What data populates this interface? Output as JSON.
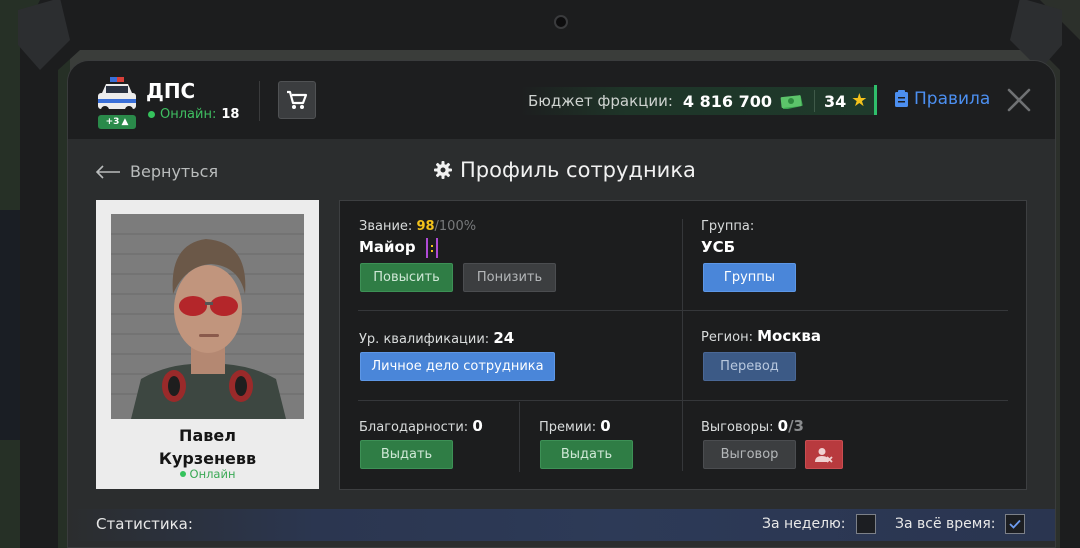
{
  "header": {
    "faction_name": "ДПС",
    "faction_badge": "+3",
    "online_label": "Онлайн:",
    "online_count": "18",
    "budget_label": "Бюджет фракции:",
    "budget_value": "4 816 700",
    "stars_value": "34",
    "rules_label": "Правила"
  },
  "nav": {
    "back_label": "Вернуться",
    "title": "Профиль сотрудника"
  },
  "profile": {
    "first_name": "Павел",
    "last_name": "Курзеневв",
    "status": "Онлайн"
  },
  "info": {
    "rank_label": "Звание:",
    "rank_progress": "98",
    "rank_progress_tail": "/100%",
    "rank_name": "Майор",
    "promote_label": "Повысить",
    "demote_label": "Понизить",
    "group_label": "Группа:",
    "group_name": "УСБ",
    "groups_button": "Группы",
    "qualification_label": "Ур. квалификации:",
    "qualification_value": "24",
    "personal_file_button": "Личное дело сотрудника",
    "region_label": "Регион:",
    "region_value": "Москва",
    "transfer_button": "Перевод",
    "thanks_label": "Благодарности:",
    "thanks_value": "0",
    "thanks_button": "Выдать",
    "bonuses_label": "Премии:",
    "bonuses_value": "0",
    "bonuses_button": "Выдать",
    "reprimands_label": "Выговоры:",
    "reprimands_value": "0",
    "reprimands_max": "/3",
    "reprimand_button": "Выговор"
  },
  "stats": {
    "label": "Статистика:",
    "week_label": "За неделю:",
    "week_checked": false,
    "all_time_label": "За всё время:",
    "all_time_checked": true
  },
  "colors": {
    "accent_green": "#2f7d45",
    "accent_blue": "#4a86d9",
    "rank_yellow": "#f3c21b",
    "online_green": "#35c25c",
    "danger_red": "#b83a3e"
  },
  "icons": [
    "police-car-icon",
    "cart-icon",
    "cash-icon",
    "star-icon",
    "clipboard-icon",
    "close-icon",
    "arrow-left-icon",
    "gear-icon",
    "rank-stripes-icon",
    "user-remove-icon",
    "checkmark-icon"
  ]
}
